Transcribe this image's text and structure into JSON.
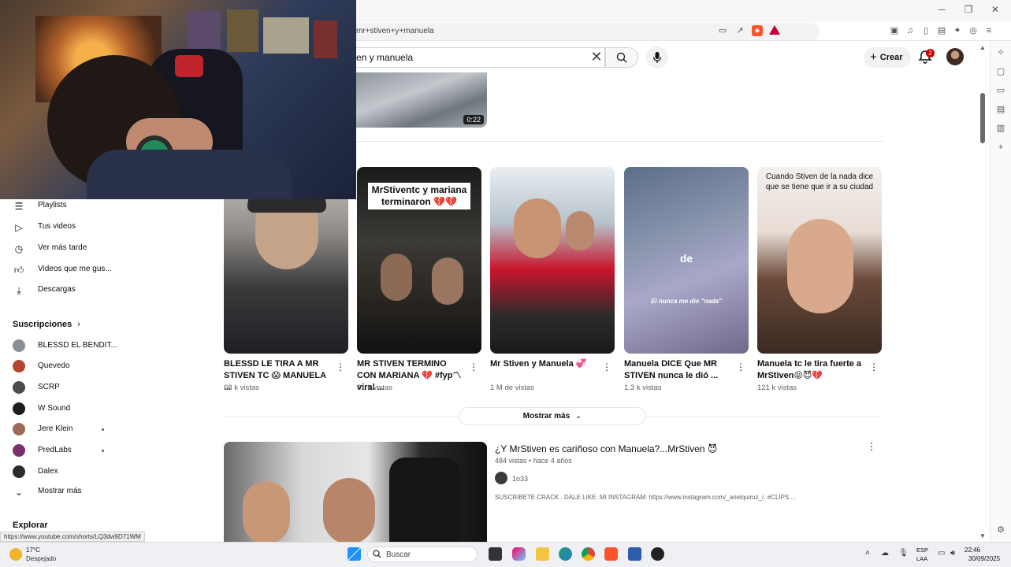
{
  "browser": {
    "url": "mr+stiven+y+manuela",
    "status_url": "https://www.youtube.com/shorts/LQ3dw9D71WM"
  },
  "youtube": {
    "search_value": "en y manuela",
    "create_label": "Crear",
    "notification_count": "2"
  },
  "nav": {
    "items": [
      {
        "label": "Playlists",
        "icon": "playlist-icon"
      },
      {
        "label": "Tus videos",
        "icon": "video-icon"
      },
      {
        "label": "Ver más tarde",
        "icon": "clock-icon"
      },
      {
        "label": "Videos que me gus...",
        "icon": "thumbs-up-icon"
      },
      {
        "label": "Descargas",
        "icon": "download-icon"
      }
    ],
    "subs_heading": "Suscripciones",
    "subscriptions": [
      {
        "name": "BLESSD EL BENDIT...",
        "color": "#8a8f96",
        "dot": false
      },
      {
        "name": "Quevedo",
        "color": "#b4452f",
        "dot": false
      },
      {
        "name": "SCRP",
        "color": "#4b4b4b",
        "dot": false
      },
      {
        "name": "W Sound",
        "color": "#1e1e1e",
        "dot": false
      },
      {
        "name": "Jere Klein",
        "color": "#9c6b55",
        "dot": true
      },
      {
        "name": "PredLabs",
        "color": "#7a2f6e",
        "dot": true
      },
      {
        "name": "Dalex",
        "color": "#2b2b2b",
        "dot": false
      }
    ],
    "show_more": "Mostrar más",
    "explore_heading": "Explorar"
  },
  "previous_video": {
    "duration": "0:22"
  },
  "shorts": [
    {
      "title": "BLESSD LE TIRA A MR STIVEN TC 😱 MANUELA ...",
      "views": "68 k vistas",
      "overlay": ""
    },
    {
      "title": "MR STIVEN TERMINO CON MARIANA 💔 #fyp〽viral ...",
      "views": "31 k vistas",
      "overlay": "MrStiventc y mariana terminaron 💔💔"
    },
    {
      "title": "Mr Stiven y Manuela 💞",
      "views": "1 M de vistas",
      "overlay": ""
    },
    {
      "title": "Manuela DICE Que MR STIVEN nunca le dió ...",
      "views": "1.3 k vistas",
      "overlay": "de"
    },
    {
      "title": "Manuela tc le tira fuerte a MrStiven😝😈💔",
      "views": "121 k vistas",
      "overlay": "Cuando Stiven de la nada dice que se tiene que ir a su ciudad"
    }
  ],
  "short3_caption": "El nunca me dio \"nada\"",
  "show_more_button": "Mostrar más",
  "video": {
    "title": "¿Y MrStiven es cariñoso con Manuela?...MrStiven 😈",
    "meta": "484 vistas • hace 4 años",
    "channel": "1o33",
    "description": "SUSCRIBETE CRACK . DALE LIKE. MI INSTAGRAM: https://www.instagram.com/_arielquiroz_/. #CLIPS ..."
  },
  "taskbar": {
    "temperature": "17°C",
    "condition": "Despejado",
    "search_label": "Buscar",
    "lang_line1": "ESP",
    "lang_line2": "LAA",
    "time": "22:46",
    "date": "30/09/2025"
  }
}
